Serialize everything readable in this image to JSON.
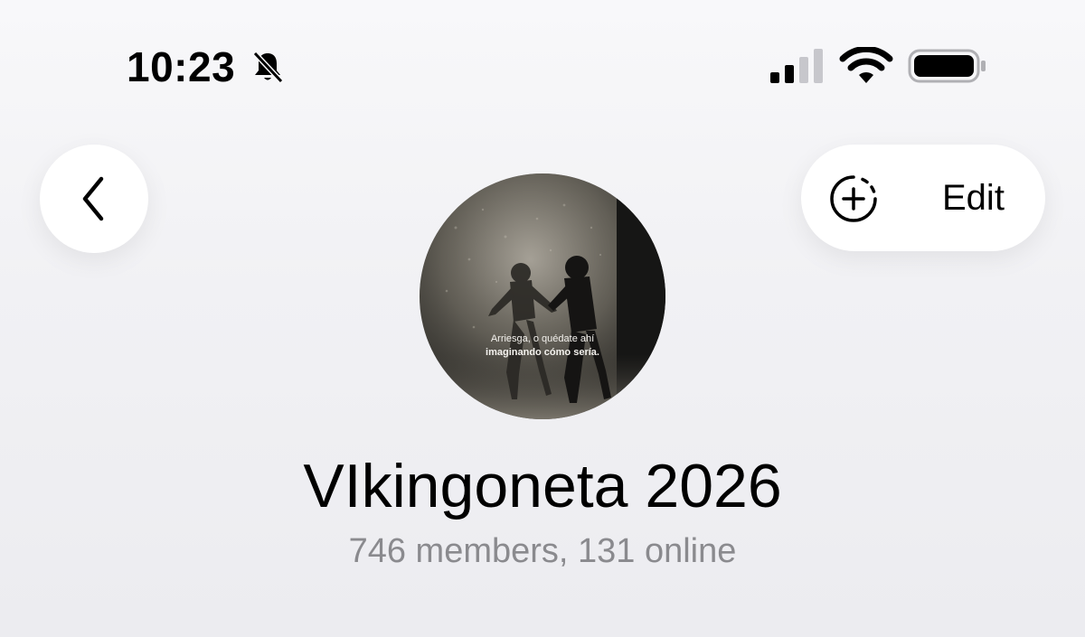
{
  "status_bar": {
    "time": "10:23",
    "icons": [
      "bell-slash-icon",
      "cellular-signal-icon",
      "wifi-icon",
      "battery-icon"
    ]
  },
  "nav": {
    "back_icon": "chevron-left-icon",
    "edit_icon": "add-circle-icon",
    "edit_label": "Edit"
  },
  "avatar": {
    "caption_line1": "Arriesga, o quédate ahí",
    "caption_line2": "imaginando cómo sería."
  },
  "group": {
    "title": "VIkingoneta 2026",
    "subtitle": "746 members, 131 online"
  },
  "colors": {
    "background": "#f1f1f4",
    "button_bg": "#ffffff",
    "subtitle_text": "#8a8a8e"
  }
}
